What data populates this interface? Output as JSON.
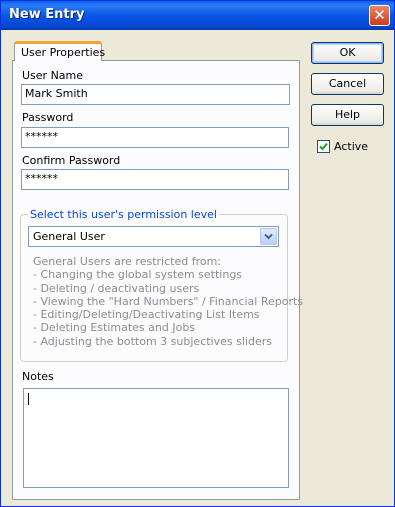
{
  "window": {
    "title": "New Entry",
    "close_glyph": "✕"
  },
  "tabs": [
    {
      "label": "User Properties"
    }
  ],
  "form": {
    "user_name_label": "User Name",
    "user_name_value": "Mark Smith",
    "password_label": "Password",
    "password_value": "******",
    "confirm_password_label": "Confirm Password",
    "confirm_password_value": "******",
    "permission_group_label": "Select this user's permission level",
    "permission_selected": "General User",
    "restriction_lines": [
      "General Users are restricted from:",
      "- Changing the global system settings",
      "- Deleting / deactivating users",
      "- Viewing the \"Hard Numbers\" / Financial Reports",
      "- Editing/Deleting/Deactivating List Items",
      "- Deleting Estimates and Jobs",
      "- Adjusting the bottom 3 subjectives sliders"
    ],
    "notes_label": "Notes",
    "notes_value": ""
  },
  "buttons": {
    "ok": "OK",
    "cancel": "Cancel",
    "help": "Help"
  },
  "active": {
    "label": "Active",
    "checked": true,
    "check_glyph": "✓"
  },
  "colors": {
    "titlebar": "#0a56e6",
    "dialog_bg": "#ece9d8",
    "tab_accent": "#f4a23a",
    "group_label": "#0046d5",
    "disabled_text": "#8c8c8c"
  }
}
